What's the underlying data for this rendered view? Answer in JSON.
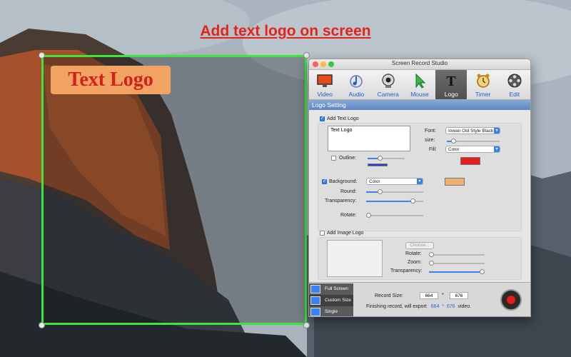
{
  "headline": "Add text logo on screen",
  "overlay_logo": {
    "text": "Text Logo",
    "bg_color": "#f0a362",
    "text_color": "#d4201c"
  },
  "window": {
    "title": "Screen Record Studio",
    "tabs": [
      {
        "label": "Video",
        "icon": "video-icon"
      },
      {
        "label": "Audio",
        "icon": "audio-icon"
      },
      {
        "label": "Camera",
        "icon": "camera-icon"
      },
      {
        "label": "Mouse",
        "icon": "mouse-pointer-icon"
      },
      {
        "label": "Logo",
        "icon": "logo-text-icon"
      },
      {
        "label": "Timer",
        "icon": "timer-icon"
      },
      {
        "label": "Edit",
        "icon": "film-edit-icon"
      }
    ],
    "active_tab": "Logo",
    "section_title": "Logo Setting"
  },
  "text_logo": {
    "checkbox_label": "Add Text Logo",
    "checked": true,
    "text_value": "Text Logo",
    "font_label": "Font:",
    "font_value": "Iowan Old Style Black",
    "size_label": "size:",
    "fill_label": "Fill:",
    "fill_value": "Color",
    "fill_color": "#e81d1d",
    "outline_label": "Outline:",
    "outline_checked": false,
    "outline_color": "#2244cc",
    "background_label": "Background:",
    "background_checked": true,
    "background_value": "Color",
    "background_color": "#f0b070",
    "round_label": "Round:",
    "transparency_label": "Transparency:",
    "rotate_label": "Rotate:"
  },
  "image_logo": {
    "checkbox_label": "Add Image Logo",
    "checked": false,
    "choose_label": "Choose...",
    "rotate_label": "Rotate:",
    "zoom_label": "Zoom:",
    "transparency_label": "Transparency:"
  },
  "bottom": {
    "modes": [
      "Full Screen",
      "Custom Size",
      "Single Window"
    ],
    "selected_mode": "Custom Size",
    "record_size_label": "Record Size:",
    "width": "664",
    "times": "*",
    "height": "676",
    "finishing_prefix": "Finishing record, will export",
    "export_width": "664",
    "export_height": "676",
    "finishing_suffix": "video."
  }
}
